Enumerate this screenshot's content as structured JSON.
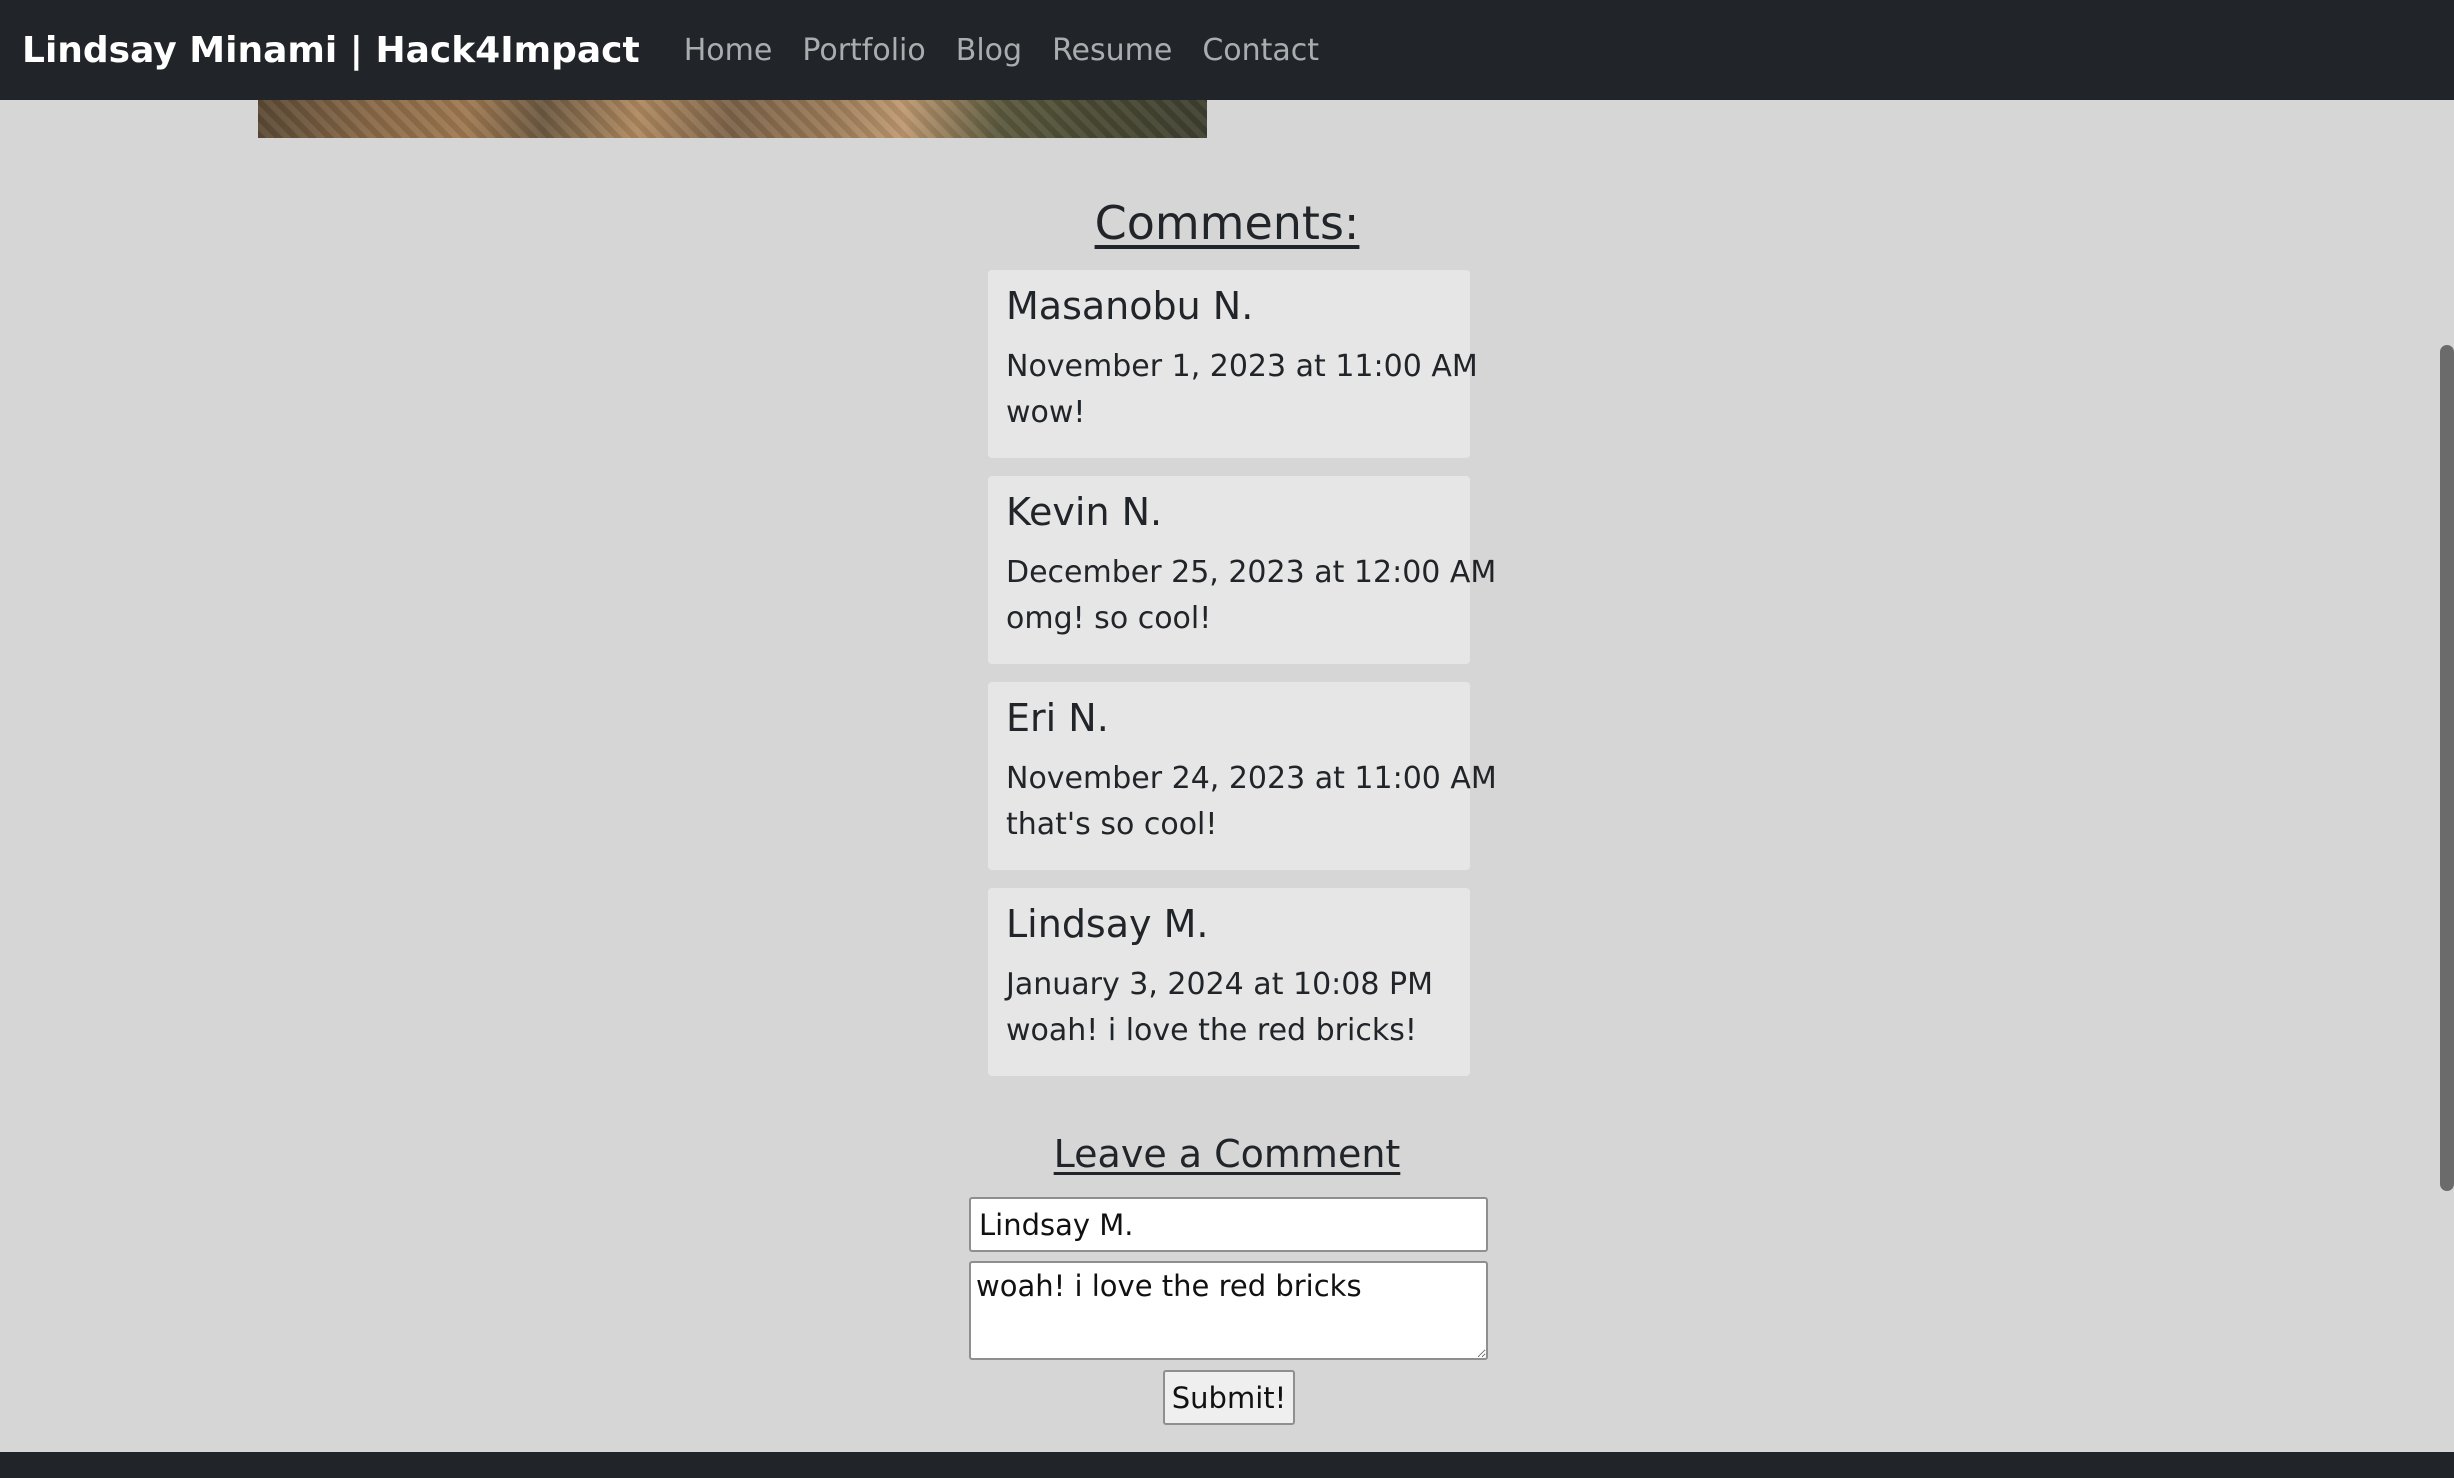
{
  "navbar": {
    "brand": "Lindsay Minami | Hack4Impact",
    "links": [
      "Home",
      "Portfolio",
      "Blog",
      "Resume",
      "Contact"
    ]
  },
  "comments": {
    "title": "Comments:",
    "items": [
      {
        "author": "Masanobu N.",
        "date": "November 1, 2023 at 11:00 AM",
        "text": "wow!"
      },
      {
        "author": "Kevin N.",
        "date": "December 25, 2023 at 12:00 AM",
        "text": "omg! so cool!"
      },
      {
        "author": "Eri N.",
        "date": "November 24, 2023 at 11:00 AM",
        "text": "that's so cool!"
      },
      {
        "author": "Lindsay M.",
        "date": "January 3, 2024 at 10:08 PM",
        "text": "woah! i love the red bricks!"
      }
    ]
  },
  "form": {
    "title": "Leave a Comment",
    "name_value": "Lindsay M.",
    "comment_value": "woah! i love the red bricks",
    "submit_label": "Submit!"
  }
}
